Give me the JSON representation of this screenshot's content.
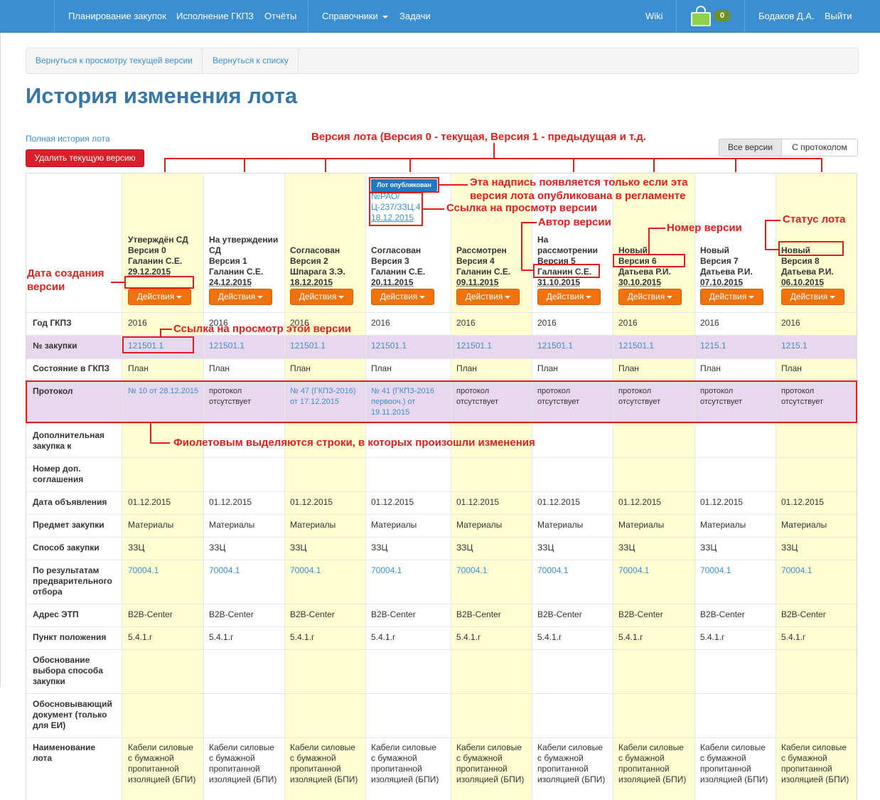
{
  "nav": {
    "items": [
      "Планирование закупок",
      "Исполнение ГКПЗ",
      "Отчёты",
      "Справочники",
      "Задачи"
    ],
    "wiki": "Wiki",
    "cart_count": "0",
    "user": "Бодаков Д.А.",
    "logout": "Выйти"
  },
  "breadcrumbs": [
    "Вернуться к просмотру текущей версии",
    "Вернуться к списку"
  ],
  "page_title": "История изменения лота",
  "full_history_link": "Полная история лота",
  "delete_button": "Удалить текущую версию",
  "view_toggle": [
    "Все версии",
    "С протоколом"
  ],
  "published_badge": "Лот опубликован",
  "published_link": "№РАО/Ц-237/ЗЗЦ.4",
  "published_date": "18.12.2015",
  "actions_label": "Действия",
  "versions": [
    {
      "status": "Утверждён СД",
      "version": "Версия 0",
      "author": "Галанин С.Е.",
      "date": "29.12.2015"
    },
    {
      "status": "На утверждении СД",
      "version": "Версия 1",
      "author": "Галанин С.Е.",
      "date": "24.12.2015"
    },
    {
      "status": "Согласован",
      "version": "Версия 2",
      "author": "Шпарага З.Э.",
      "date": "18.12.2015"
    },
    {
      "status": "Согласован",
      "version": "Версия 3",
      "author": "Галанин С.Е.",
      "date": "20.11.2015"
    },
    {
      "status": "Рассмотрен",
      "version": "Версия 4",
      "author": "Галанин С.Е.",
      "date": "09.11.2015"
    },
    {
      "status": "На рассмотрении",
      "version": "Версия 5",
      "author": "Галанин С.Е.",
      "date": "31.10.2015"
    },
    {
      "status": "Новый",
      "version": "Версия 6",
      "author": "Датьева Р.И.",
      "date": "30.10.2015"
    },
    {
      "status": "Новый",
      "version": "Версия 7",
      "author": "Датьева Р.И.",
      "date": "07.10.2015"
    },
    {
      "status": "Новый",
      "version": "Версия 8",
      "author": "Датьева Р.И.",
      "date": "06.10.2015"
    }
  ],
  "row_labels": {
    "year": "Год ГКПЗ",
    "purchase_no": "№ закупки",
    "state": "Состояние в ГКПЗ",
    "protocol": "Протокол",
    "additional": "Дополнительная закупка к",
    "agreement": "Номер доп. соглашения",
    "announce_date": "Дата объявления",
    "subject": "Предмет закупки",
    "method": "Способ закупки",
    "preselection": "По результатам предварительного отбора",
    "etp": "Адрес ЭТП",
    "clause": "Пункт положения",
    "justification": "Обоснование выбора способа закупки",
    "document": "Обосновывающий документ (только для ЕИ)",
    "lot_name": "Наименование лота"
  },
  "rows": {
    "year": [
      "2016",
      "2016",
      "2016",
      "2016",
      "2016",
      "2016",
      "2016",
      "2016",
      "2016"
    ],
    "purchase_no": [
      "121501.1",
      "121501.1",
      "121501.1",
      "121501.1",
      "121501.1",
      "121501.1",
      "121501.1",
      "1215.1",
      "1215.1"
    ],
    "state": [
      "План",
      "План",
      "План",
      "План",
      "План",
      "План",
      "План",
      "План",
      "План"
    ],
    "protocol": [
      "№ 10 от 28.12.2015",
      "протокол отсутствует",
      "№ 47 (ГКПЗ-2016) от 17.12.2015",
      "№ 41 (ГКПЗ-2016 первооч.) от 19.11.2015",
      "протокол отсутствует",
      "протокол отсутствует",
      "протокол отсутствует",
      "протокол отсутствует",
      "протокол отсутствует"
    ],
    "announce_date": [
      "01.12.2015",
      "01.12.2015",
      "01.12.2015",
      "01.12.2015",
      "01.12.2015",
      "01.12.2015",
      "01.12.2015",
      "01.12.2015",
      "01.12.2015"
    ],
    "subject": [
      "Материалы",
      "Материалы",
      "Материалы",
      "Материалы",
      "Материалы",
      "Материалы",
      "Материалы",
      "Материалы",
      "Материалы"
    ],
    "method": [
      "ЗЗЦ",
      "ЗЗЦ",
      "ЗЗЦ",
      "ЗЗЦ",
      "ЗЗЦ",
      "ЗЗЦ",
      "ЗЗЦ",
      "ЗЗЦ",
      "ЗЗЦ"
    ],
    "preselection": [
      "70004.1",
      "70004.1",
      "70004.1",
      "70004.1",
      "70004.1",
      "70004.1",
      "70004.1",
      "70004.1",
      "70004.1"
    ],
    "etp": [
      "B2B-Center",
      "B2B-Center",
      "B2B-Center",
      "B2B-Center",
      "B2B-Center",
      "B2B-Center",
      "B2B-Center",
      "B2B-Center",
      "B2B-Center"
    ],
    "clause": [
      "5.4.1.г",
      "5.4.1.г",
      "5.4.1.г",
      "5.4.1.г",
      "5.4.1.г",
      "5.4.1.г",
      "5.4.1.г",
      "5.4.1.г",
      "5.4.1.г"
    ],
    "lot_name": [
      "Кабели силовые с бумажной пропитанной изоляцией (БПИ)",
      "Кабели силовые с бумажной пропитанной изоляцией (БПИ)",
      "Кабели силовые с бумажной пропитанной изоляцией (БПИ)",
      "Кабели силовые с бумажной пропитанной изоляцией (БПИ)",
      "Кабели силовые с бумажной пропитанной изоляцией (БПИ)",
      "Кабели силовые с бумажной пропитанной изоляцией (БПИ)",
      "Кабели силовые с бумажной пропитанной изоляцией (БПИ)",
      "Кабели силовые с бумажной пропитанной изоляцией (БПИ)",
      "Кабели силовые с бумажной пропитанной изоляцией (БПИ)"
    ]
  },
  "annotations": {
    "version_header": "Версия лота (Версия 0 - текущая, Версия 1 - предыдущая и т.д.",
    "published_note_1": "Эта надпись появляется только если эта",
    "published_note_2": "версия лота опубликована в регламенте",
    "view_link": "Ссылка на просмотр версии",
    "author": "Автор версии",
    "version_no": "Номер версии",
    "lot_status": "Статус лота",
    "created_date_1": "Дата создания",
    "created_date_2": "версии",
    "row_link": "Ссылка на просмотр этой версии",
    "purple_rows": "Фиолетовым выделяются строки, в которых произошли изменения"
  },
  "colors": {
    "navbar": "#3b8fd0",
    "accent_orange": "#f0720f",
    "delete_red": "#d9202a",
    "changed_row": "#e8d8ee",
    "version_column": "#fefed2",
    "annotation": "#e0201c"
  }
}
